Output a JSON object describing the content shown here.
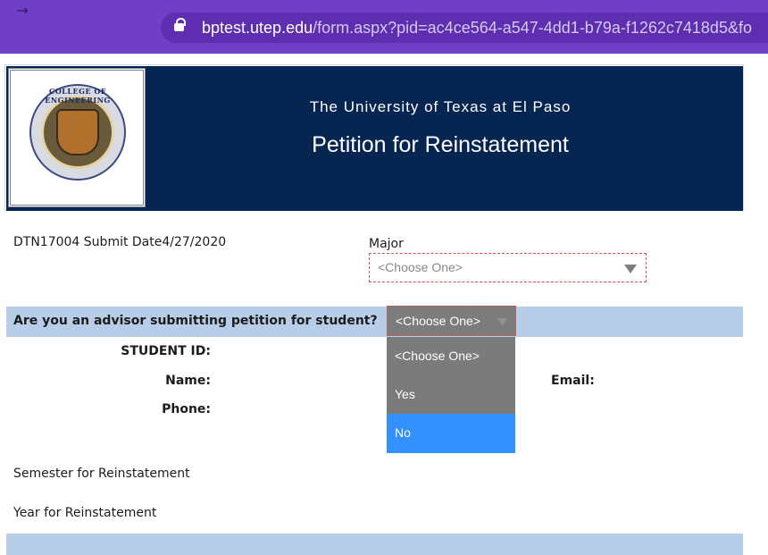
{
  "browser": {
    "url_host": "bptest.utep.edu",
    "url_path": "/form.aspx?pid=ac4ce564-a547-4dd1-b79a-f1262c7418d5&fo",
    "back_icon": "←",
    "forward_icon": "→",
    "reload_icon": "C",
    "home_icon": "⌂"
  },
  "header": {
    "university": "The University of Texas at El Paso",
    "title": "Petition for Reinstatement",
    "seal_text": "COLLEGE OF ENGINEERING"
  },
  "form": {
    "dtn": "DTN17004  Submit Date4/27/2020",
    "major_label": "Major",
    "major_value": "<Choose One>",
    "advisor_question": "Are you an advisor submitting petition for student?",
    "advisor_value": "<Choose One>",
    "advisor_options": [
      "<Choose One>",
      "Yes",
      "No"
    ],
    "student_id_label": "STUDENT ID:",
    "name_label": "Name:",
    "phone_label": "Phone:",
    "email_label": "Email:",
    "semester_label": "Semester for Reinstatement",
    "year_label": "Year for Reinstatement"
  },
  "colors": {
    "browser_bar": "#6f3fc7",
    "banner": "#062551",
    "section_bar": "#b7cde8",
    "highlight_option": "#3390ff"
  }
}
